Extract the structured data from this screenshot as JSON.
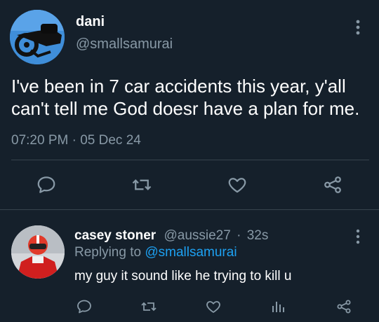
{
  "main_tweet": {
    "display_name": "dani",
    "handle": "@smallsamurai",
    "text": "I've been in 7 car accidents this year, y'all can't tell me God doesr have a plan for me.",
    "timestamp": "07:20 PM · 05 Dec 24",
    "actions": [
      "reply-icon",
      "retweet-icon",
      "like-icon",
      "share-icon"
    ],
    "avatar_icon": "motorcycle-avatar"
  },
  "reply_tweet": {
    "display_name": "casey stoner",
    "handle": "@aussie27",
    "separator": "·",
    "age": "32s",
    "replying_prefix": "Replying to",
    "replying_to": "@smallsamurai",
    "text": "my guy it sound like he trying to kill u",
    "actions": [
      "reply-icon",
      "retweet-icon",
      "like-icon",
      "analytics-icon",
      "share-icon"
    ],
    "avatar_icon": "racer-avatar"
  },
  "colors": {
    "background": "#15202b",
    "text_primary": "#ffffff",
    "text_secondary": "#8899a6",
    "accent": "#1da1f2",
    "divider": "#38444d"
  }
}
